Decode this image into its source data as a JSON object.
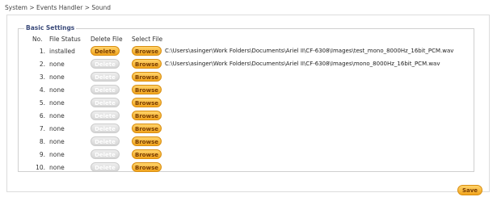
{
  "breadcrumb": "System > Events Handler > Sound",
  "section": {
    "title": "Basic Settings",
    "headers": {
      "no": "No.",
      "file_status": "File Status",
      "delete_file": "Delete File",
      "select_file": "Select File"
    }
  },
  "buttons": {
    "delete": "Delete",
    "browse": "Browse",
    "save": "Save"
  },
  "rows": [
    {
      "no": "1.",
      "status": "installed",
      "delete_enabled": true,
      "path": "C:\\Users\\asinger\\Work Folders\\Documents\\Ariel II\\CF-6308\\Images\\test_mono_8000Hz_16bit_PCM.wav"
    },
    {
      "no": "2.",
      "status": "none",
      "delete_enabled": false,
      "path": "C:\\Users\\asinger\\Work Folders\\Documents\\Ariel II\\CF-6308\\Images\\mono_8000Hz_16bit_PCM.wav"
    },
    {
      "no": "3.",
      "status": "none",
      "delete_enabled": false,
      "path": ""
    },
    {
      "no": "4.",
      "status": "none",
      "delete_enabled": false,
      "path": ""
    },
    {
      "no": "5.",
      "status": "none",
      "delete_enabled": false,
      "path": ""
    },
    {
      "no": "6.",
      "status": "none",
      "delete_enabled": false,
      "path": ""
    },
    {
      "no": "7.",
      "status": "none",
      "delete_enabled": false,
      "path": ""
    },
    {
      "no": "8.",
      "status": "none",
      "delete_enabled": false,
      "path": ""
    },
    {
      "no": "9.",
      "status": "none",
      "delete_enabled": false,
      "path": ""
    },
    {
      "no": "10.",
      "status": "none",
      "delete_enabled": false,
      "path": ""
    }
  ],
  "colors": {
    "accent": "#f2a51e",
    "disabled": "#d6d6d6",
    "legend": "#3a4a7a"
  }
}
